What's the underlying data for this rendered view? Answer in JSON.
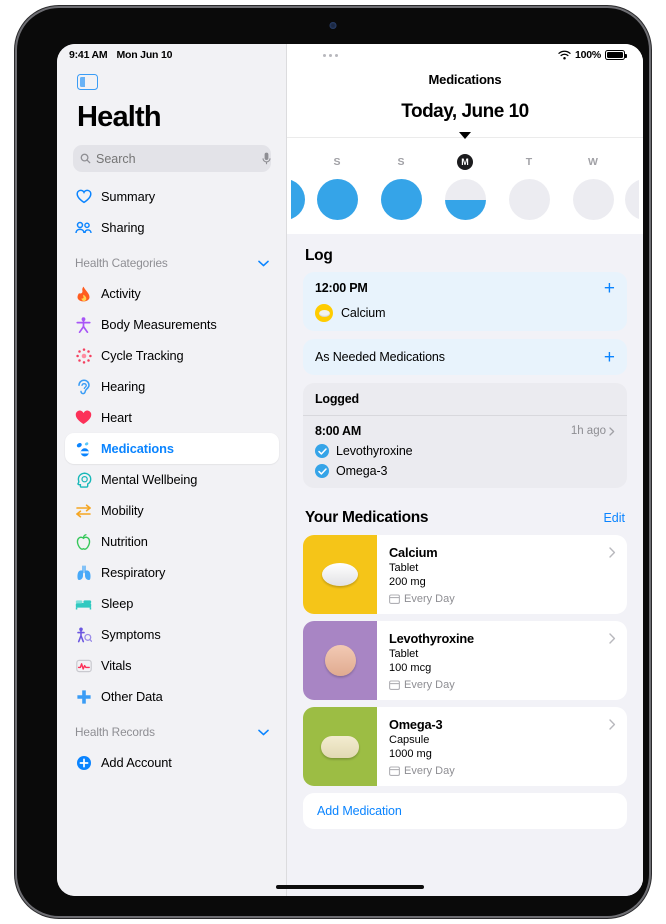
{
  "status_bar": {
    "time": "9:41 AM",
    "date": "Mon Jun 10",
    "battery_percent": "100%",
    "wifi_icon": "wifi-icon",
    "battery_icon": "battery-icon"
  },
  "sidebar": {
    "toggle_icon": "sidebar-toggle-icon",
    "app_title": "Health",
    "search": {
      "placeholder": "Search",
      "value": "",
      "search_icon": "search-icon",
      "mic_icon": "microphone-icon"
    },
    "top_items": [
      {
        "label": "Summary",
        "icon": "heart-outline-icon",
        "color": "#0a84ff"
      },
      {
        "label": "Sharing",
        "icon": "people-icon",
        "color": "#0a84ff"
      }
    ],
    "categories_header": {
      "label": "Health Categories",
      "chevron": "chevron-down-icon"
    },
    "categories": [
      {
        "label": "Activity",
        "icon": "flame-icon",
        "color": "#ff5c1f"
      },
      {
        "label": "Body Measurements",
        "icon": "body-icon",
        "color": "#a855f7"
      },
      {
        "label": "Cycle Tracking",
        "icon": "cycle-icon",
        "color": "#f43f5e"
      },
      {
        "label": "Hearing",
        "icon": "ear-icon",
        "color": "#3a9cf5"
      },
      {
        "label": "Heart",
        "icon": "heart-filled-icon",
        "color": "#fc3158"
      },
      {
        "label": "Medications",
        "icon": "pills-icon",
        "color": "#0a84ff",
        "selected": true
      },
      {
        "label": "Mental Wellbeing",
        "icon": "head-icon",
        "color": "#17b8b8"
      },
      {
        "label": "Mobility",
        "icon": "arrows-icon",
        "color": "#f5a623"
      },
      {
        "label": "Nutrition",
        "icon": "apple-icon",
        "color": "#35c759"
      },
      {
        "label": "Respiratory",
        "icon": "lungs-icon",
        "color": "#48a9f8"
      },
      {
        "label": "Sleep",
        "icon": "bed-icon",
        "color": "#30c9c0"
      },
      {
        "label": "Symptoms",
        "icon": "symptoms-icon",
        "color": "#6b56e0"
      },
      {
        "label": "Vitals",
        "icon": "vitals-icon",
        "color": "#fc3158"
      },
      {
        "label": "Other Data",
        "icon": "plus-cross-icon",
        "color": "#3a9cf5"
      }
    ],
    "records_header": {
      "label": "Health Records",
      "chevron": "chevron-down-icon"
    },
    "add_account": {
      "label": "Add Account",
      "icon": "plus-circle-icon",
      "color": "#0a84ff"
    }
  },
  "main": {
    "menu_icon": "more-dots-icon",
    "nav_title": "Medications",
    "date_title": "Today, June 10",
    "day_strip": [
      {
        "label": "",
        "state": "full",
        "edge": "left"
      },
      {
        "label": "S",
        "state": "full"
      },
      {
        "label": "S",
        "state": "full"
      },
      {
        "label": "M",
        "state": "half",
        "today": true
      },
      {
        "label": "T",
        "state": "empty"
      },
      {
        "label": "W",
        "state": "empty"
      },
      {
        "label": "",
        "state": "empty",
        "edge": "right"
      }
    ],
    "log": {
      "section_title": "Log",
      "scheduled": {
        "time": "12:00 PM",
        "add_label": "+",
        "medication": "Calcium",
        "pill_color": "#ffcc00"
      },
      "as_needed": {
        "label": "As Needed Medications",
        "add_label": "+"
      },
      "logged": {
        "header": "Logged",
        "time": "8:00 AM",
        "ago": "1h ago",
        "items": [
          {
            "label": "Levothyroxine",
            "checked": true
          },
          {
            "label": "Omega-3",
            "checked": true
          }
        ]
      }
    },
    "your_medications": {
      "section_title": "Your Medications",
      "edit_label": "Edit",
      "items": [
        {
          "name": "Calcium",
          "form": "Tablet",
          "dose": "200 mg",
          "frequency": "Every Day",
          "thumb_color": "#f5c518",
          "pill_shape": "tablet"
        },
        {
          "name": "Levothyroxine",
          "form": "Tablet",
          "dose": "100 mcg",
          "frequency": "Every Day",
          "thumb_color": "#a885c4",
          "pill_shape": "round"
        },
        {
          "name": "Omega-3",
          "form": "Capsule",
          "dose": "1000 mg",
          "frequency": "Every Day",
          "thumb_color": "#9cbd44",
          "pill_shape": "capsule"
        }
      ],
      "add_label": "Add Medication"
    }
  }
}
